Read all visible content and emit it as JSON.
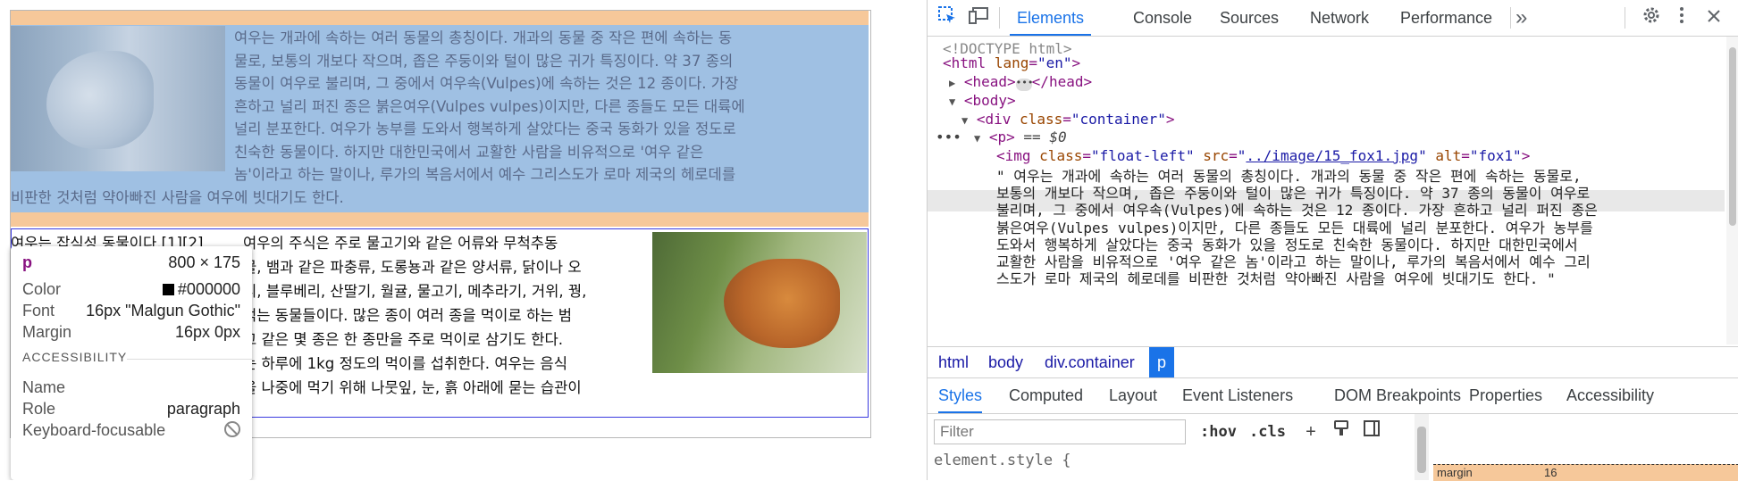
{
  "page": {
    "para1_lines": [
      "여우는 개과에 속하는 여러 동물의 총칭이다. 개과의 동물 중 작은 편에 속하는 동",
      "물로, 보통의 개보다 작으며, 좁은 주둥이와 털이 많은 귀가 특징이다. 약 37 종의",
      "동물이 여우로 불리며, 그 중에서 여우속(Vulpes)에 속하는 것은 12 종이다. 가장",
      "흔하고 널리 퍼진 종은 붉은여우(Vulpes vulpes)이지만, 다른 종들도 모든 대륙에",
      "널리 분포한다. 여우가 농부를 도와서 행복하게 살았다는 중국 동화가 있을 정도로",
      "친숙한 동물이다. 하지만 대한민국에서 교활한 사람을 비유적으로 '여우 같은",
      "놈'이라고 하는 말이나, 루가의 복음서에서 예수 그리스도가 로마 제국의 헤로데를"
    ],
    "para1_tail": "비판한 것처럼 약아빠진 사람을 여우에 빗대기도 한다.",
    "para2_first": "여우는 잡식성 동물이다.[1][2]",
    "para2_lines": [
      "여우의 주식은 주로 물고기와 같은 어류와 무척추동",
      "물, 뱀과 같은 파충류, 도롱뇽과 같은 양서류, 닭이나 오",
      "리, 블루베리, 산딸기, 월귤, 물고기, 메추라기, 거위, 꿩,",
      "먹는 동물들이다. 많은 종이 여러 종을 먹이로 하는 범",
      "고 같은 몇 종은 한 종만을 주로 먹이로 삼기도 한다.",
      "는 하루에 1kg 정도의 먹이를 섭취한다. 여우는 음식",
      "을 나중에 먹기 위해 나뭇잎, 눈, 흙 아래에 묻는 습관이"
    ],
    "img1_alt": "fox1",
    "img2_alt": "fox2"
  },
  "tooltip": {
    "tag": "p",
    "size": "800 × 175",
    "color_label": "Color",
    "color_value": "#000000",
    "font_label": "Font",
    "font_value": "16px \"Malgun Gothic\"",
    "margin_label": "Margin",
    "margin_value": "16px 0px",
    "accessibility_heading": "ACCESSIBILITY",
    "name_label": "Name",
    "role_label": "Role",
    "role_value": "paragraph",
    "keyboard_label": "Keyboard-focusable"
  },
  "devtools": {
    "tabs": [
      "Elements",
      "Console",
      "Sources",
      "Network",
      "Performance"
    ],
    "active_tab": "Elements",
    "more_tabs": "»",
    "dom": {
      "doctype": "<!DOCTYPE html>",
      "html_open_tag": "<html",
      "html_attr": "lang",
      "html_attr_val": "\"en\"",
      "head_open": "<head>",
      "head_close": "</head>",
      "body_open": "<body>",
      "div_tag": "<div",
      "div_attr": "class",
      "div_attr_val": "\"container\"",
      "p_tag": "<p>",
      "p_selected": "== $0",
      "img_tag": "<img",
      "img_class_attr": "class",
      "img_class_val": "\"float-left\"",
      "img_src_attr": "src",
      "img_src_val": "../image/15_fox1.jpg",
      "img_alt_attr": "alt",
      "img_alt_val": "\"fox1\"",
      "text_lines": [
        "\" 여우는 개과에 속하는 여러 동물의 총칭이다. 개과의 동물 중 작은 편에 속하는 동물로,",
        "보통의 개보다 작으며, 좁은 주둥이와 털이 많은 귀가 특징이다. 약 37 종의 동물이 여우로",
        "불리며, 그 중에서 여우속(Vulpes)에 속하는 것은 12 종이다. 가장 흔하고 널리 퍼진 종은",
        "붉은여우(Vulpes vulpes)이지만, 다른 종들도 모든 대륙에 널리 분포한다. 여우가 농부를",
        "도와서 행복하게 살았다는 중국 동화가 있을 정도로 친숙한 동물이다. 하지만 대한민국에서",
        "교활한 사람을 비유적으로 '여우 같은 놈'이라고 하는 말이나, 루가의 복음서에서 예수 그리",
        "스도가 로마 제국의 헤로데를 비판한 것처럼 약아빠진 사람을 여우에 빗대기도 한다. \""
      ]
    },
    "breadcrumbs": [
      "html",
      "body",
      "div.container",
      "p"
    ],
    "subtabs": [
      "Styles",
      "Computed",
      "Layout",
      "Event Listeners",
      "DOM Breakpoints",
      "Properties",
      "Accessibility"
    ],
    "active_subtab": "Styles",
    "filter_placeholder": "Filter",
    "hov_label": ":hov",
    "cls_label": ".cls",
    "element_style": "element.style {",
    "box_margin_label": "margin",
    "box_margin_value": "16"
  }
}
